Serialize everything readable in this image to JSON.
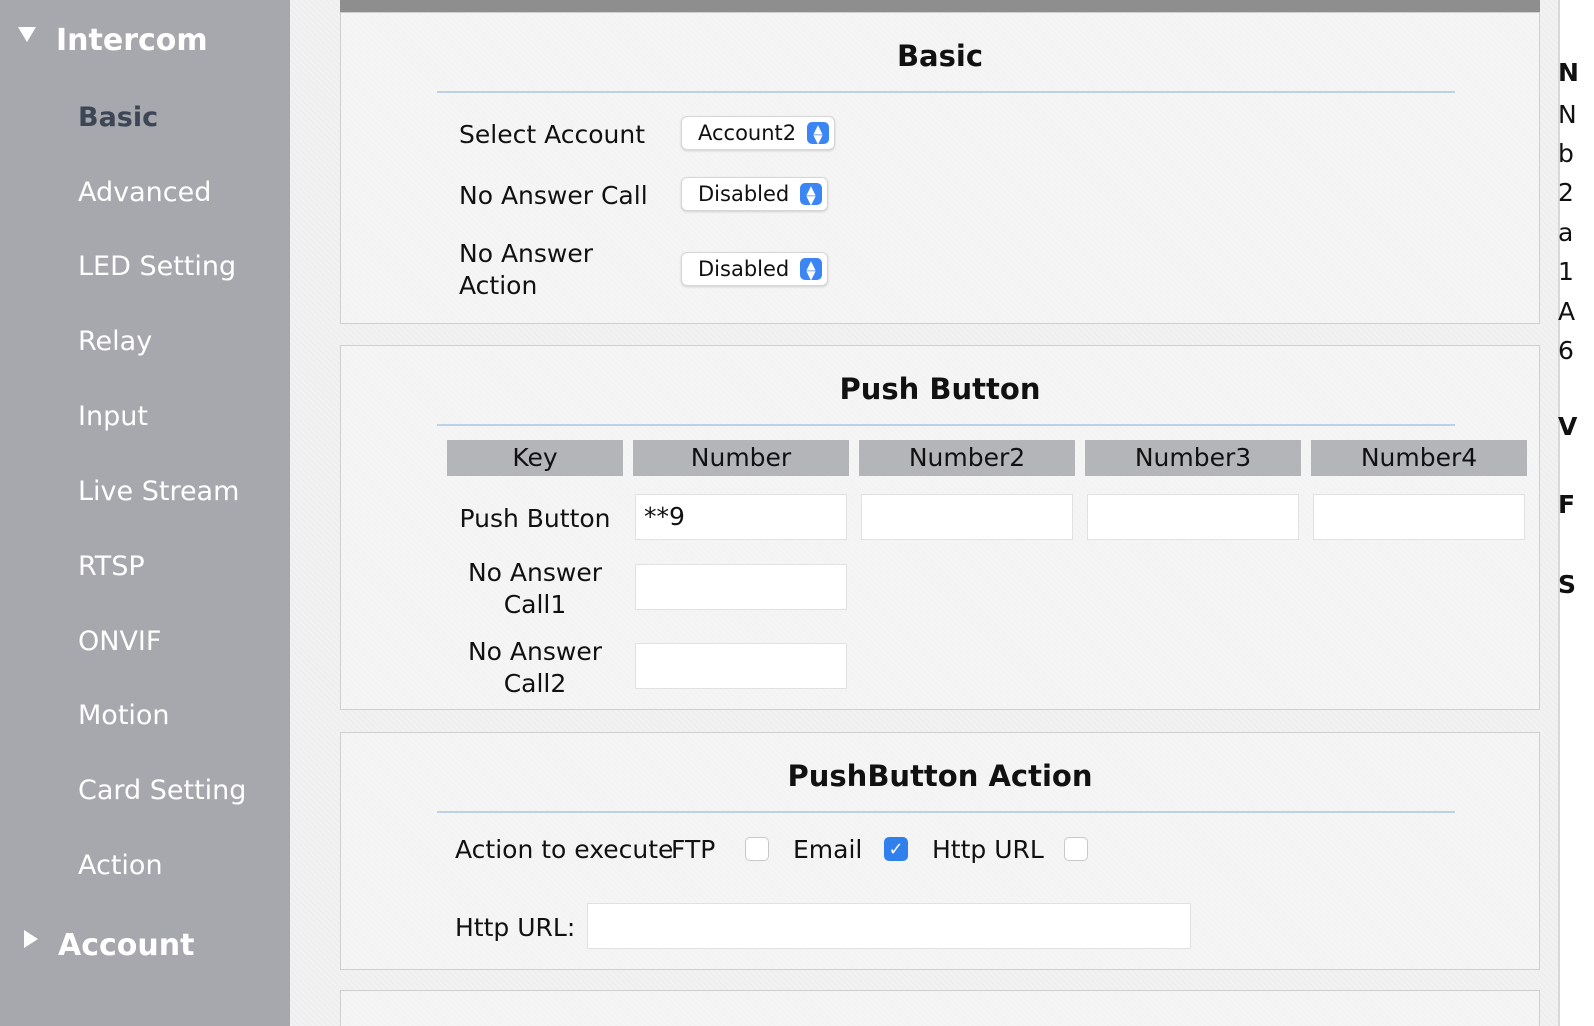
{
  "sidebar": {
    "group_intercom": "Intercom",
    "items": [
      "Basic",
      "Advanced",
      "LED Setting",
      "Relay",
      "Input",
      "Live Stream",
      "RTSP",
      "ONVIF",
      "Motion",
      "Card Setting",
      "Action"
    ],
    "group_account": "Account"
  },
  "basic": {
    "title": "Basic",
    "select_account_label": "Select Account",
    "select_account_value": "Account2",
    "no_answer_call_label": "No Answer Call",
    "no_answer_call_value": "Disabled",
    "no_answer_action_label": "No Answer Action",
    "no_answer_action_value": "Disabled"
  },
  "push_button": {
    "title": "Push Button",
    "headers": [
      "Key",
      "Number",
      "Number2",
      "Number3",
      "Number4"
    ],
    "row1_label": "Push Button",
    "row1_values": [
      "**9",
      "",
      "",
      ""
    ],
    "row2_label": "No Answer Call1",
    "row2_value": "",
    "row3_label": "No Answer Call2",
    "row3_value": ""
  },
  "pushbutton_action": {
    "title": "PushButton Action",
    "action_label": "Action to execute",
    "opt_ftp": "FTP",
    "opt_email": "Email",
    "opt_http": "Http URL",
    "ftp_checked": false,
    "email_checked": true,
    "http_checked": false,
    "http_url_label": "Http URL:",
    "http_url_value": ""
  },
  "right_column_chars": [
    "N",
    "N",
    "b",
    "2",
    "a",
    "1",
    "A",
    "6",
    "V",
    "F",
    "S"
  ],
  "colors": {
    "sidebar_bg": "#a6a8ad",
    "active_item": "#3d4654",
    "accent": "#3b86f4",
    "table_header": "#b3b5b9"
  }
}
